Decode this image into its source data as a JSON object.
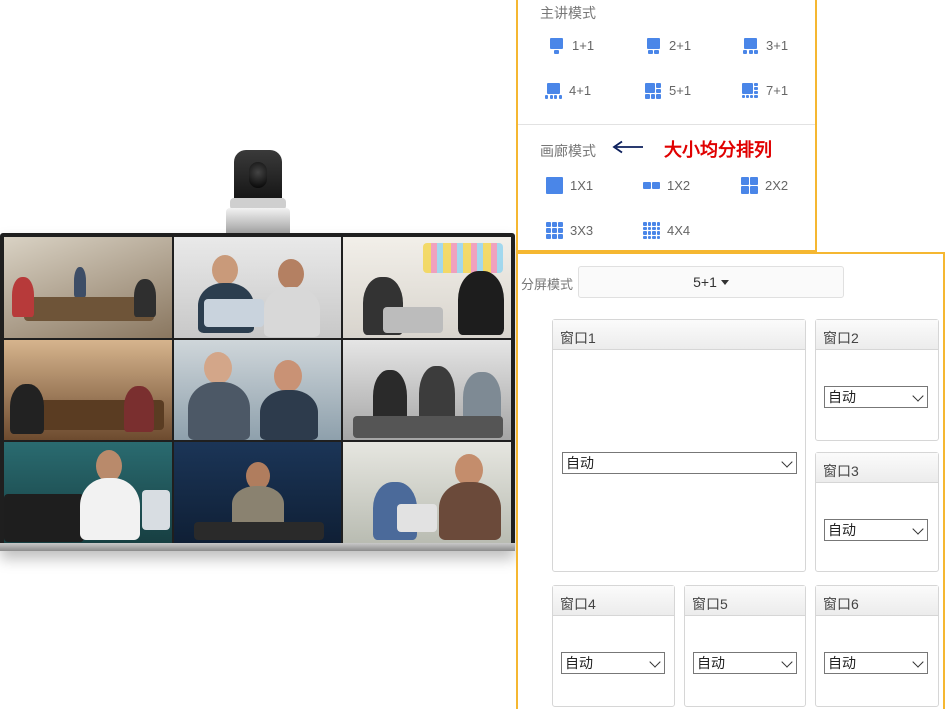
{
  "presenter_mode": {
    "title": "主讲模式",
    "items": [
      {
        "label": "1+1",
        "icon": "layout-1plus1-icon"
      },
      {
        "label": "2+1",
        "icon": "layout-2plus1-icon"
      },
      {
        "label": "3+1",
        "icon": "layout-3plus1-icon"
      },
      {
        "label": "4+1",
        "icon": "layout-4plus1-icon"
      },
      {
        "label": "5+1",
        "icon": "layout-5plus1-icon"
      },
      {
        "label": "7+1",
        "icon": "layout-7plus1-icon"
      }
    ]
  },
  "gallery_mode": {
    "title": "画廊模式",
    "annotation": "大小均分排列",
    "items": [
      {
        "label": "1X1",
        "icon": "grid-1x1-icon"
      },
      {
        "label": "1X2",
        "icon": "grid-1x2-icon"
      },
      {
        "label": "2X2",
        "icon": "grid-2x2-icon"
      },
      {
        "label": "3X3",
        "icon": "grid-3x3-icon"
      },
      {
        "label": "4X4",
        "icon": "grid-4x4-icon"
      }
    ]
  },
  "split_screen": {
    "label": "分屏模式",
    "selected": "5+1",
    "windows": [
      {
        "title": "窗口1",
        "value": "自动"
      },
      {
        "title": "窗口2",
        "value": "自动"
      },
      {
        "title": "窗口3",
        "value": "自动"
      },
      {
        "title": "窗口4",
        "value": "自动"
      },
      {
        "title": "窗口5",
        "value": "自动"
      },
      {
        "title": "窗口6",
        "value": "自动"
      }
    ]
  },
  "colors": {
    "accent_border": "#f5b731",
    "icon_blue": "#4a86e8",
    "annotation_red": "#e00000"
  }
}
